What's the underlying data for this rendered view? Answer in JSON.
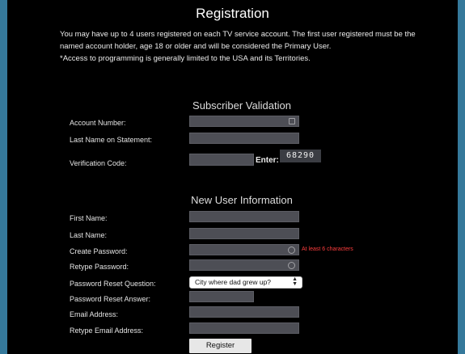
{
  "page": {
    "title": "Registration",
    "intro_line1": "You may have up to 4 users registered on each TV service account. The first user registered must be the named account holder, age 18 or older and will be considered the Primary User.",
    "intro_line2": "*Access to programming is generally limited to the USA and its Territories."
  },
  "subscriber_validation": {
    "heading": "Subscriber Validation",
    "account_number_label": "Account Number:",
    "last_name_label": "Last Name on Statement:",
    "verification_code_label": "Verification Code:",
    "enter_label": "Enter:",
    "captcha_code": "68290"
  },
  "new_user": {
    "heading": "New User Information",
    "first_name_label": "First Name:",
    "last_name_label": "Last Name:",
    "create_password_label": "Create Password:",
    "password_hint": "At least 6 characters",
    "retype_password_label": "Retype Password:",
    "reset_question_label": "Password Reset Question:",
    "reset_question_value": "City where dad grew up?",
    "reset_answer_label": "Password Reset Answer:",
    "email_label": "Email Address:",
    "retype_email_label": "Retype Email Address:",
    "register_label": "Register"
  },
  "colors": {
    "page_background": "#35799b",
    "panel_background": "#000000",
    "field_background": "#4d4e55",
    "hint_color": "#ff3d3d"
  }
}
